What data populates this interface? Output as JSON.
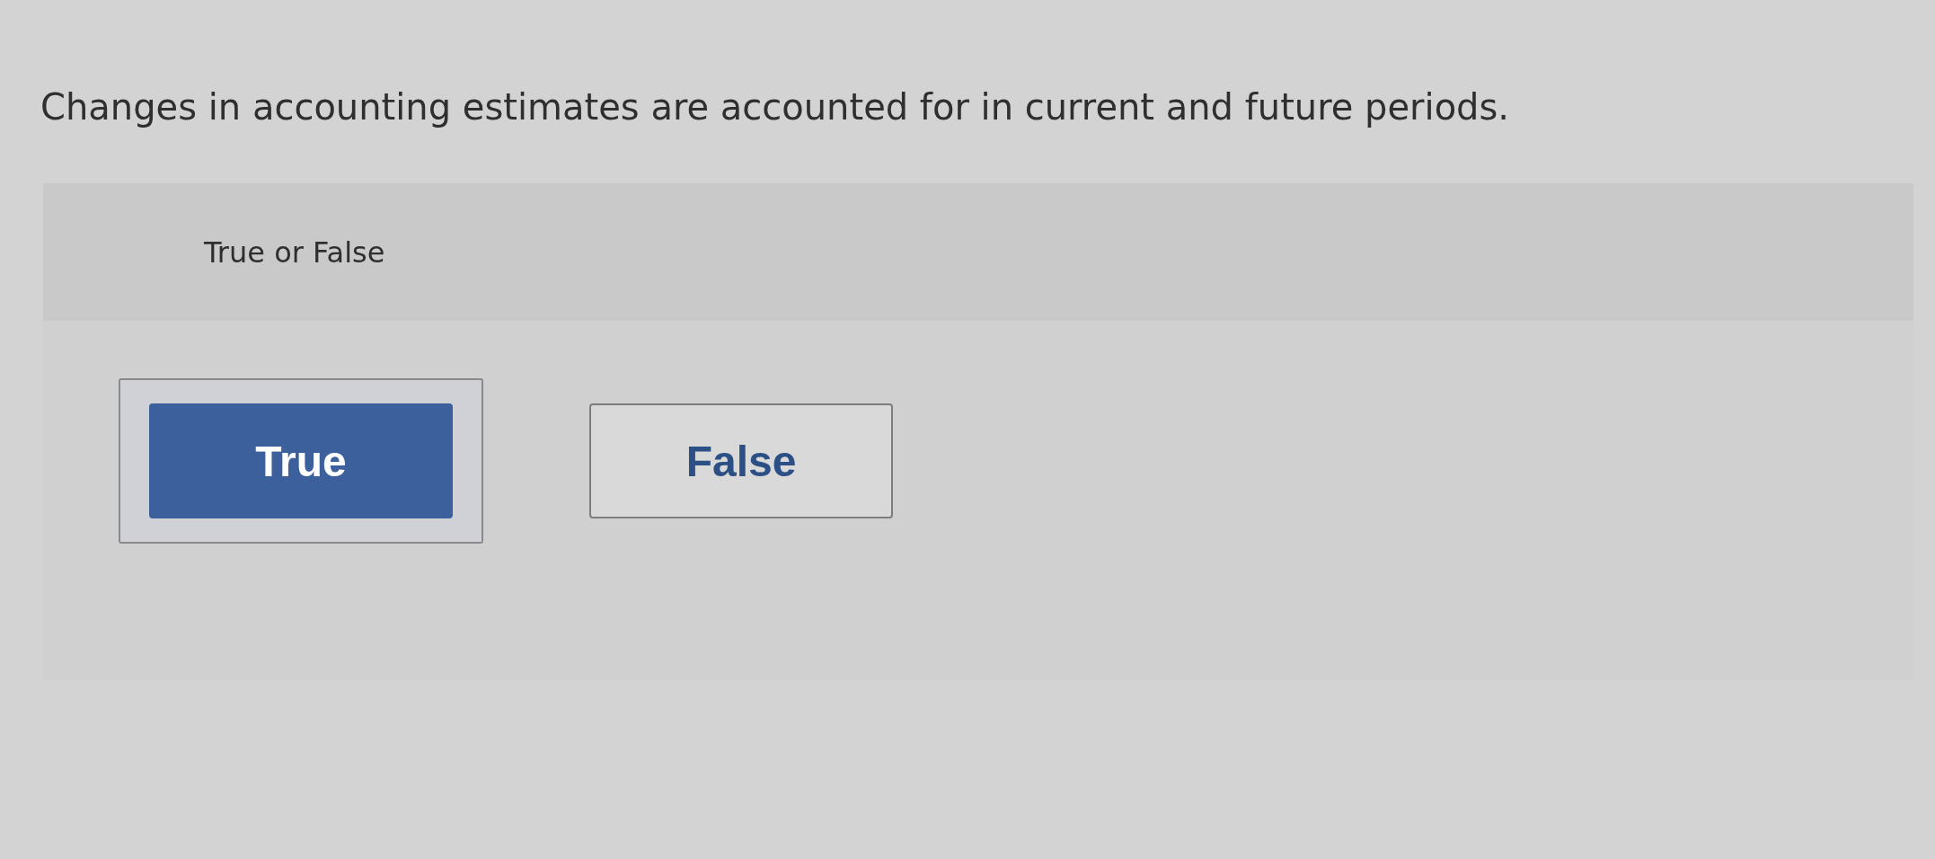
{
  "question": "Changes in accounting estimates are accounted for in current and future periods.",
  "panel": {
    "prompt": "True or False",
    "options": [
      {
        "label": "True",
        "selected": true
      },
      {
        "label": "False",
        "selected": false
      }
    ]
  }
}
